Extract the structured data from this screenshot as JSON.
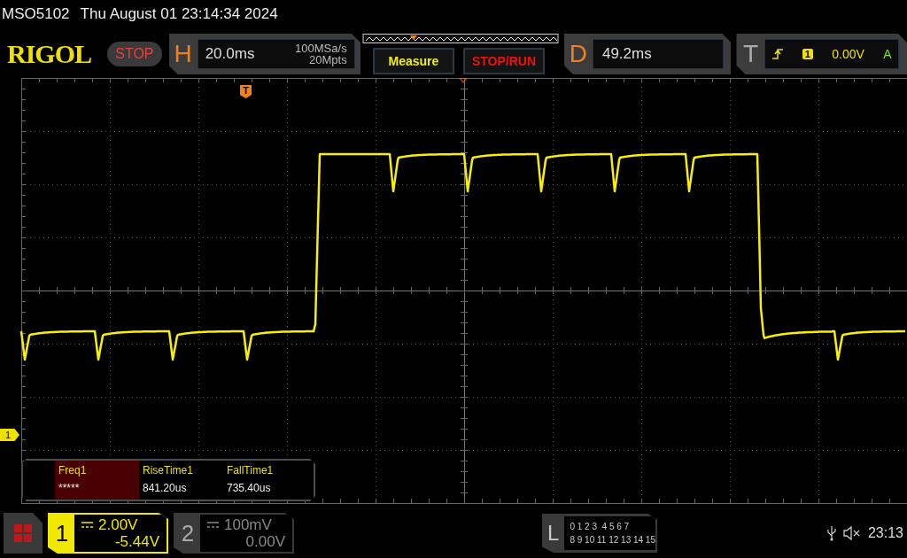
{
  "header": {
    "model": "MSO5102",
    "datetime": "Thu August 01 23:14:34 2024"
  },
  "toolbar": {
    "logo": "RIGOL",
    "run_state": "STOP",
    "horizontal": {
      "label": "H",
      "timebase": "20.0ms",
      "sample_rate": "100MSa/s",
      "memory_depth": "20Mpts"
    },
    "buttons": [
      {
        "label": "Measure",
        "kind": "measure"
      },
      {
        "label": "STOP/RUN",
        "kind": "stoprun"
      }
    ],
    "delay": {
      "label": "D",
      "value": "49.2ms"
    },
    "trigger": {
      "label": "T",
      "channel": "1",
      "level": "0.00V",
      "mode": "A"
    }
  },
  "display": {
    "trigger_position_marker": "T",
    "channel_marker": "1",
    "measurements": [
      {
        "name": "Freq1",
        "value": "*****",
        "selected": true
      },
      {
        "name": "RiseTime1",
        "value": "841.20us",
        "selected": false
      },
      {
        "name": "FallTime1",
        "value": "735.40us",
        "selected": false
      }
    ]
  },
  "footer": {
    "channels": [
      {
        "number": "1",
        "scale": "2.00V",
        "offset": "-5.44V",
        "on": true
      },
      {
        "number": "2",
        "scale": "100mV",
        "offset": "0.00V",
        "on": false
      }
    ],
    "logic": {
      "label": "L",
      "rows": [
        "0 1 2 3  4 5 6 7",
        "8 9 10 11 12 13 14 15"
      ]
    },
    "time": "23:13"
  }
}
